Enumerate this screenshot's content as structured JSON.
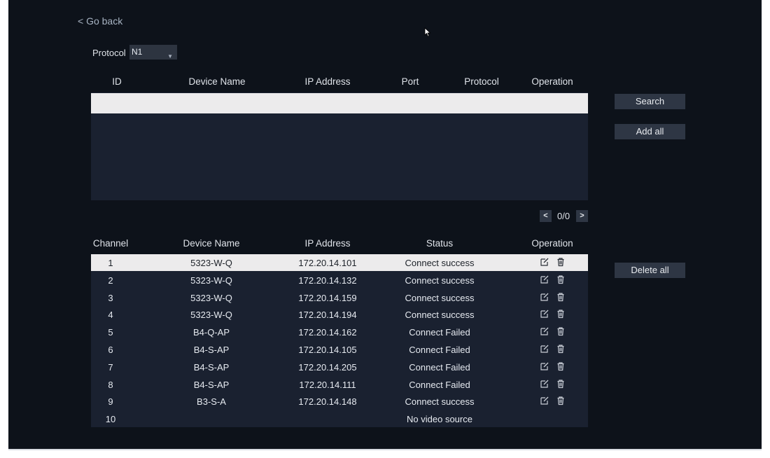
{
  "go_back": "< Go back",
  "protocol": {
    "label": "Protocol",
    "value": "N1"
  },
  "search_table": {
    "headers": [
      "ID",
      "Device Name",
      "IP Address",
      "Port",
      "Protocol",
      "Operation"
    ]
  },
  "buttons": {
    "search": "Search",
    "add_all": "Add all",
    "delete_all": "Delete all"
  },
  "pager": {
    "prev": "<",
    "text": "0/0",
    "next": ">"
  },
  "channel_table": {
    "headers": [
      "Channel",
      "Device Name",
      "IP Address",
      "Status",
      "Operation"
    ],
    "rows": [
      {
        "channel": "1",
        "device": "5323-W-Q",
        "ip": "172.20.14.101",
        "status": "Connect success",
        "ops": true
      },
      {
        "channel": "2",
        "device": "5323-W-Q",
        "ip": "172.20.14.132",
        "status": "Connect success",
        "ops": true
      },
      {
        "channel": "3",
        "device": "5323-W-Q",
        "ip": "172.20.14.159",
        "status": "Connect success",
        "ops": true
      },
      {
        "channel": "4",
        "device": "5323-W-Q",
        "ip": "172.20.14.194",
        "status": "Connect success",
        "ops": true
      },
      {
        "channel": "5",
        "device": "B4-Q-AP",
        "ip": "172.20.14.162",
        "status": "Connect Failed",
        "ops": true
      },
      {
        "channel": "6",
        "device": "B4-S-AP",
        "ip": "172.20.14.105",
        "status": "Connect Failed",
        "ops": true
      },
      {
        "channel": "7",
        "device": "B4-S-AP",
        "ip": "172.20.14.205",
        "status": "Connect Failed",
        "ops": true
      },
      {
        "channel": "8",
        "device": "B4-S-AP",
        "ip": "172.20.14.111",
        "status": "Connect Failed",
        "ops": true
      },
      {
        "channel": "9",
        "device": "B3-S-A",
        "ip": "172.20.14.148",
        "status": "Connect success",
        "ops": true
      },
      {
        "channel": "10",
        "device": "",
        "ip": "",
        "status": "No video source",
        "ops": false
      }
    ]
  },
  "icons": {
    "edit": "edit-icon",
    "delete": "trash-icon",
    "cursor": "mouse-pointer-icon"
  },
  "colors": {
    "background": "#0d121a",
    "table": "#1a2130",
    "selected_row": "#ecebec",
    "button": "#2e3644"
  }
}
